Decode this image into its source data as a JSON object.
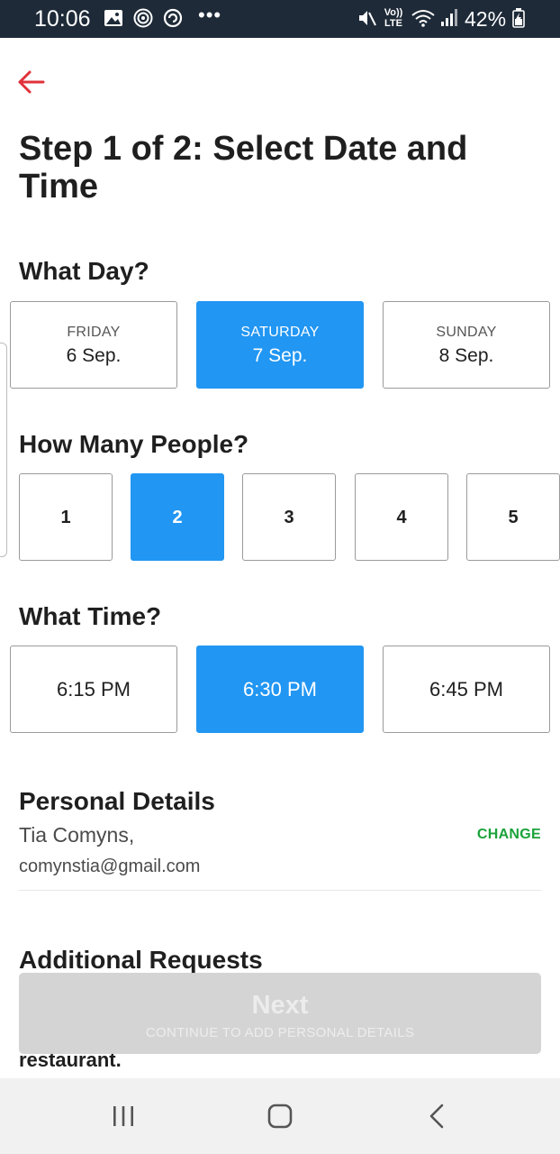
{
  "status_bar": {
    "time": "10:06",
    "volte": "Vo)) LTE",
    "battery": "42%",
    "icons": [
      "gallery-icon",
      "nfc-icon",
      "sync-icon",
      "more-dots",
      "mute-icon",
      "volte-icon",
      "wifi-icon",
      "signal-icon",
      "battery-icon"
    ]
  },
  "header": {
    "title": "Step 1 of 2: Select Date and Time"
  },
  "day_section": {
    "heading": "What Day?",
    "options": [
      {
        "name": "FRIDAY",
        "date": "6 Sep."
      },
      {
        "name": "SATURDAY",
        "date": "7 Sep."
      },
      {
        "name": "SUNDAY",
        "date": "8 Sep."
      }
    ],
    "selected": "SATURDAY"
  },
  "people_section": {
    "heading": "How Many People?",
    "options": [
      "1",
      "2",
      "3",
      "4",
      "5"
    ],
    "selected": "2"
  },
  "time_section": {
    "heading": "What Time?",
    "options": [
      "6:15 PM",
      "6:30 PM",
      "6:45 PM"
    ],
    "selected": "6:30 PM"
  },
  "personal_details": {
    "heading": "Personal Details",
    "name": "Tia Comyns,",
    "email": "comynstia@gmail.com",
    "change_label": "CHANGE"
  },
  "additional_requests": {
    "heading": "Additional Requests",
    "partial_text": "restaurant."
  },
  "next_button": {
    "label": "Next",
    "sublabel": "CONTINUE TO ADD PERSONAL DETAILS"
  },
  "colors": {
    "accent": "#2196f3",
    "back_arrow": "#e0313a",
    "change_link": "#1aa23a",
    "status_bar": "#1e2a38"
  }
}
